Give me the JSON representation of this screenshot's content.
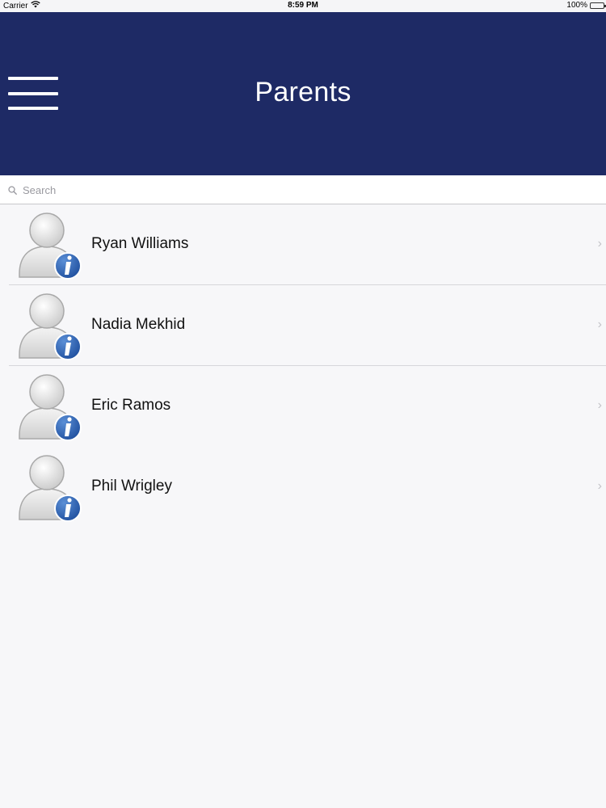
{
  "status_bar": {
    "carrier": "Carrier",
    "time": "8:59 PM",
    "battery": "100%",
    "battery_level": 1.0
  },
  "nav": {
    "title": "Parents",
    "menu_icon": "hamburger-menu-icon",
    "color": "#1e2a65"
  },
  "search": {
    "placeholder": "Search",
    "value": ""
  },
  "parents": [
    {
      "name": "Ryan Williams",
      "icon": "user-info-avatar-icon"
    },
    {
      "name": "Nadia Mekhid",
      "icon": "user-info-avatar-icon"
    },
    {
      "name": "Eric Ramos",
      "icon": "user-info-avatar-icon"
    },
    {
      "name": "Phil Wrigley",
      "icon": "user-info-avatar-icon"
    }
  ]
}
